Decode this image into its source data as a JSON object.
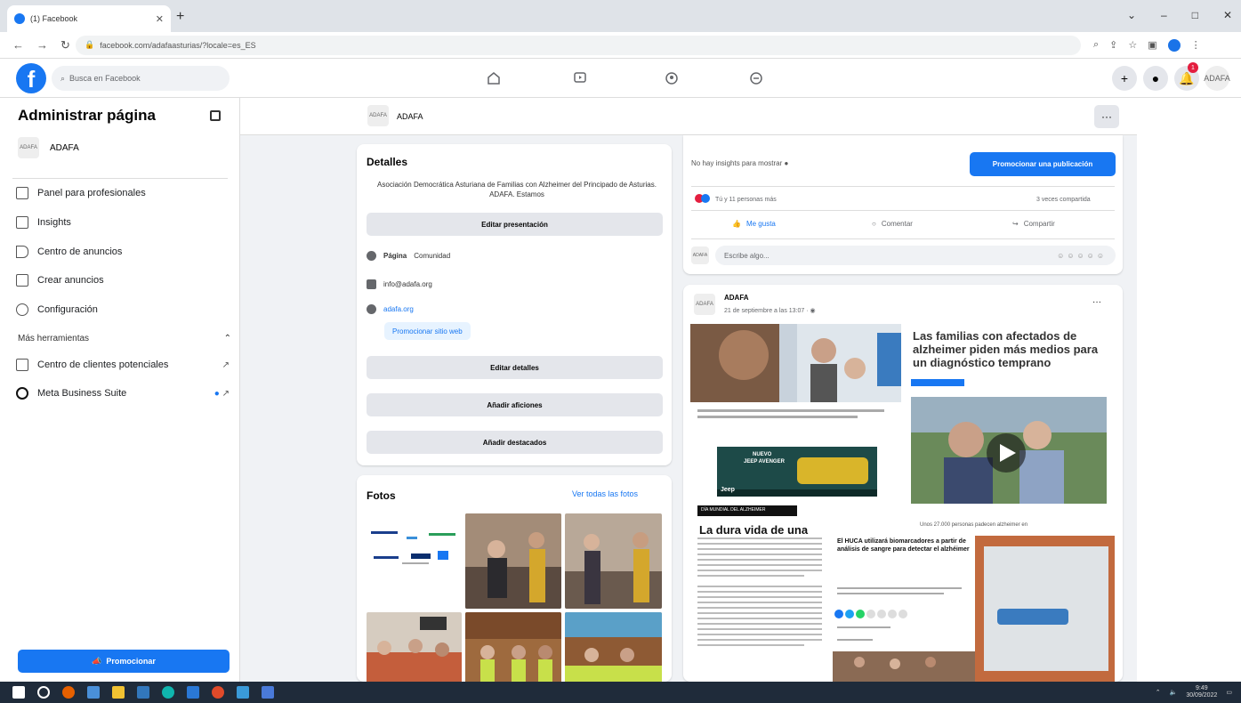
{
  "browser": {
    "tab_title": "(1) Facebook",
    "url": "facebook.com/adafaasturias/?locale=es_ES",
    "win_min": "–",
    "win_max": "□",
    "win_close": "✕",
    "new_tab": "+"
  },
  "topbar": {
    "search_placeholder": "Busca en Facebook",
    "notifications_count": "1"
  },
  "sidebar": {
    "title": "Administrar página",
    "page_name": "ADAFA",
    "items": [
      {
        "label": "Panel para profesionales"
      },
      {
        "label": "Insights"
      },
      {
        "label": "Centro de anuncios"
      },
      {
        "label": "Crear anuncios"
      },
      {
        "label": "Configuración"
      }
    ],
    "more_tools": "Más herramientas",
    "tools": [
      {
        "label": "Centro de clientes potenciales"
      },
      {
        "label": "Meta Business Suite"
      }
    ],
    "promote_label": "Promocionar"
  },
  "page_header": {
    "name": "ADAFA"
  },
  "details": {
    "title": "Detalles",
    "description": "Asociación Democrática Asturiana de Familias con Alzheimer del Principado de Asturias. ADAFA. Estamos",
    "edit_presentation": "Editar presentación",
    "page_label": "Página",
    "page_category": "Comunidad",
    "email": "info@adafa.org",
    "website": "adafa.org",
    "promote_website": "Promocionar sitio web",
    "edit_details": "Editar detalles",
    "add_hobbies": "Añadir aficiones",
    "add_featured": "Añadir destacados"
  },
  "photos": {
    "title": "Fotos",
    "see_all": "Ver todas las fotos"
  },
  "insights": {
    "no_insights": "No hay insights para mostrar",
    "promote_post": "Promocionar una publicación",
    "reactions": "Tú y 11 personas más",
    "shares": "3 veces compartida",
    "like": "Me gusta",
    "comment": "Comentar",
    "share": "Compartir",
    "comment_placeholder": "Escribe algo..."
  },
  "post": {
    "author": "ADAFA",
    "date": "21 de septiembre a las 13:07",
    "headline_right": "Las familias con afectados de alzheimer piden más medios para un diagnóstico temprano",
    "headline_left": "La dura vida de una",
    "ad_new": "NUEVO",
    "ad_model": "JEEP AVENGER",
    "ad_brand": "Jeep",
    "tag_bar": "DÍA MUNDIAL DEL ALZHEIMER",
    "sub_right": "Unos 27.000 personas padecen alzheimer en",
    "huca_headline": "El HUCA utilizará biomarcadores a partir de análisis de sangre para detectar el alzhéimer"
  },
  "taskbar": {
    "time": "9:49",
    "date": "30/09/2022"
  },
  "colors": {
    "fb_blue": "#1877f2",
    "background": "#f0f2f5"
  }
}
